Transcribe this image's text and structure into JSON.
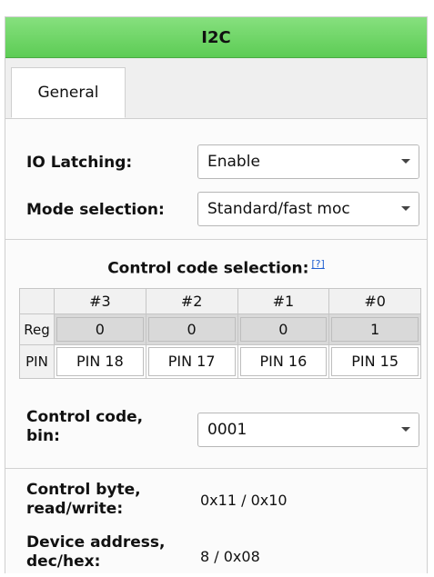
{
  "window": {
    "title": "I2C"
  },
  "tabs": [
    {
      "label": "General",
      "selected": true
    }
  ],
  "io_latching": {
    "label": "IO Latching:",
    "value": "Enable"
  },
  "mode_selection": {
    "label": "Mode selection:",
    "value": "Standard/fast moc"
  },
  "control_code_selection": {
    "title": "Control code selection:",
    "help_label": "[?]",
    "columns": [
      "#3",
      "#2",
      "#1",
      "#0"
    ],
    "rows": [
      {
        "head": "Reg",
        "cells": [
          "0",
          "0",
          "0",
          "1"
        ]
      },
      {
        "head": "PIN",
        "cells": [
          "PIN 18",
          "PIN 17",
          "PIN 16",
          "PIN 15"
        ]
      }
    ]
  },
  "control_code_bin": {
    "label_line1": "Control code,",
    "label_line2": "bin:",
    "value": "0001"
  },
  "control_byte": {
    "label_line1": "Control byte,",
    "label_line2": "read/write:",
    "value": "0x11 / 0x10"
  },
  "device_address": {
    "label_line1": "Device address,",
    "label_line2": "dec/hex:",
    "value": "8 / 0x08"
  },
  "icons": {
    "dropdown": "chevron-down-icon"
  },
  "colors": {
    "title_bar": "#5dcc55",
    "help_link": "#1f5fd1"
  }
}
